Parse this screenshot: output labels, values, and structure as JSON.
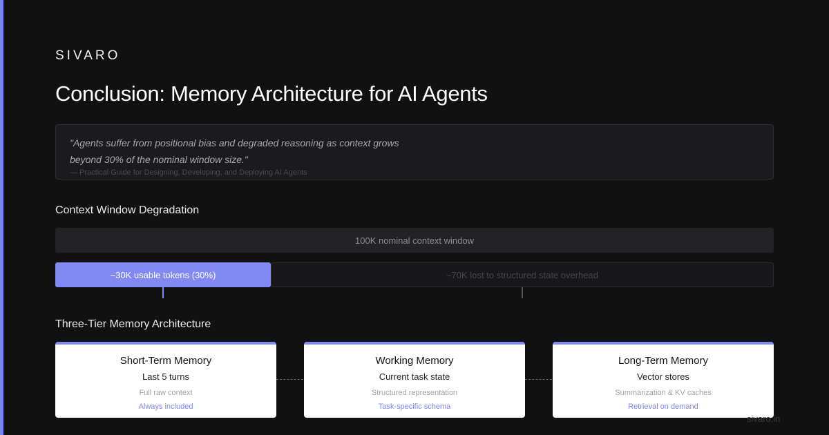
{
  "brand": "SIVARO",
  "title": "Conclusion: Memory Architecture for AI Agents",
  "quote": {
    "text": "\"Agents suffer from positional bias and degraded reasoning as context grows beyond 30% of the nominal window size.\"",
    "source": "— Practical Guide for Designing, Developing, and Deploying AI Agents"
  },
  "degradation": {
    "heading": "Context Window Degradation",
    "nominal_label": "100K nominal context window",
    "usable_label": "~30K usable tokens (30%)",
    "usable_fraction": 0.3,
    "lost_label": "~70K lost to structured state overhead",
    "colors": {
      "usable": "#8189f5",
      "lost": "#18181b"
    }
  },
  "tiers": {
    "heading": "Three-Tier Memory Architecture",
    "cards": [
      {
        "title": "Short-Term Memory",
        "subtitle": "Last 5 turns",
        "detail": "Full raw context",
        "note": "Always included"
      },
      {
        "title": "Working Memory",
        "subtitle": "Current task state",
        "detail": "Structured representation",
        "note": "Task-specific schema"
      },
      {
        "title": "Long-Term Memory",
        "subtitle": "Vector stores",
        "detail": "Summarization & KV caches",
        "note": "Retrieval on demand"
      }
    ]
  },
  "footer": "sivaro.in",
  "colors": {
    "accent": "#7b84f0",
    "background": "#111112"
  }
}
